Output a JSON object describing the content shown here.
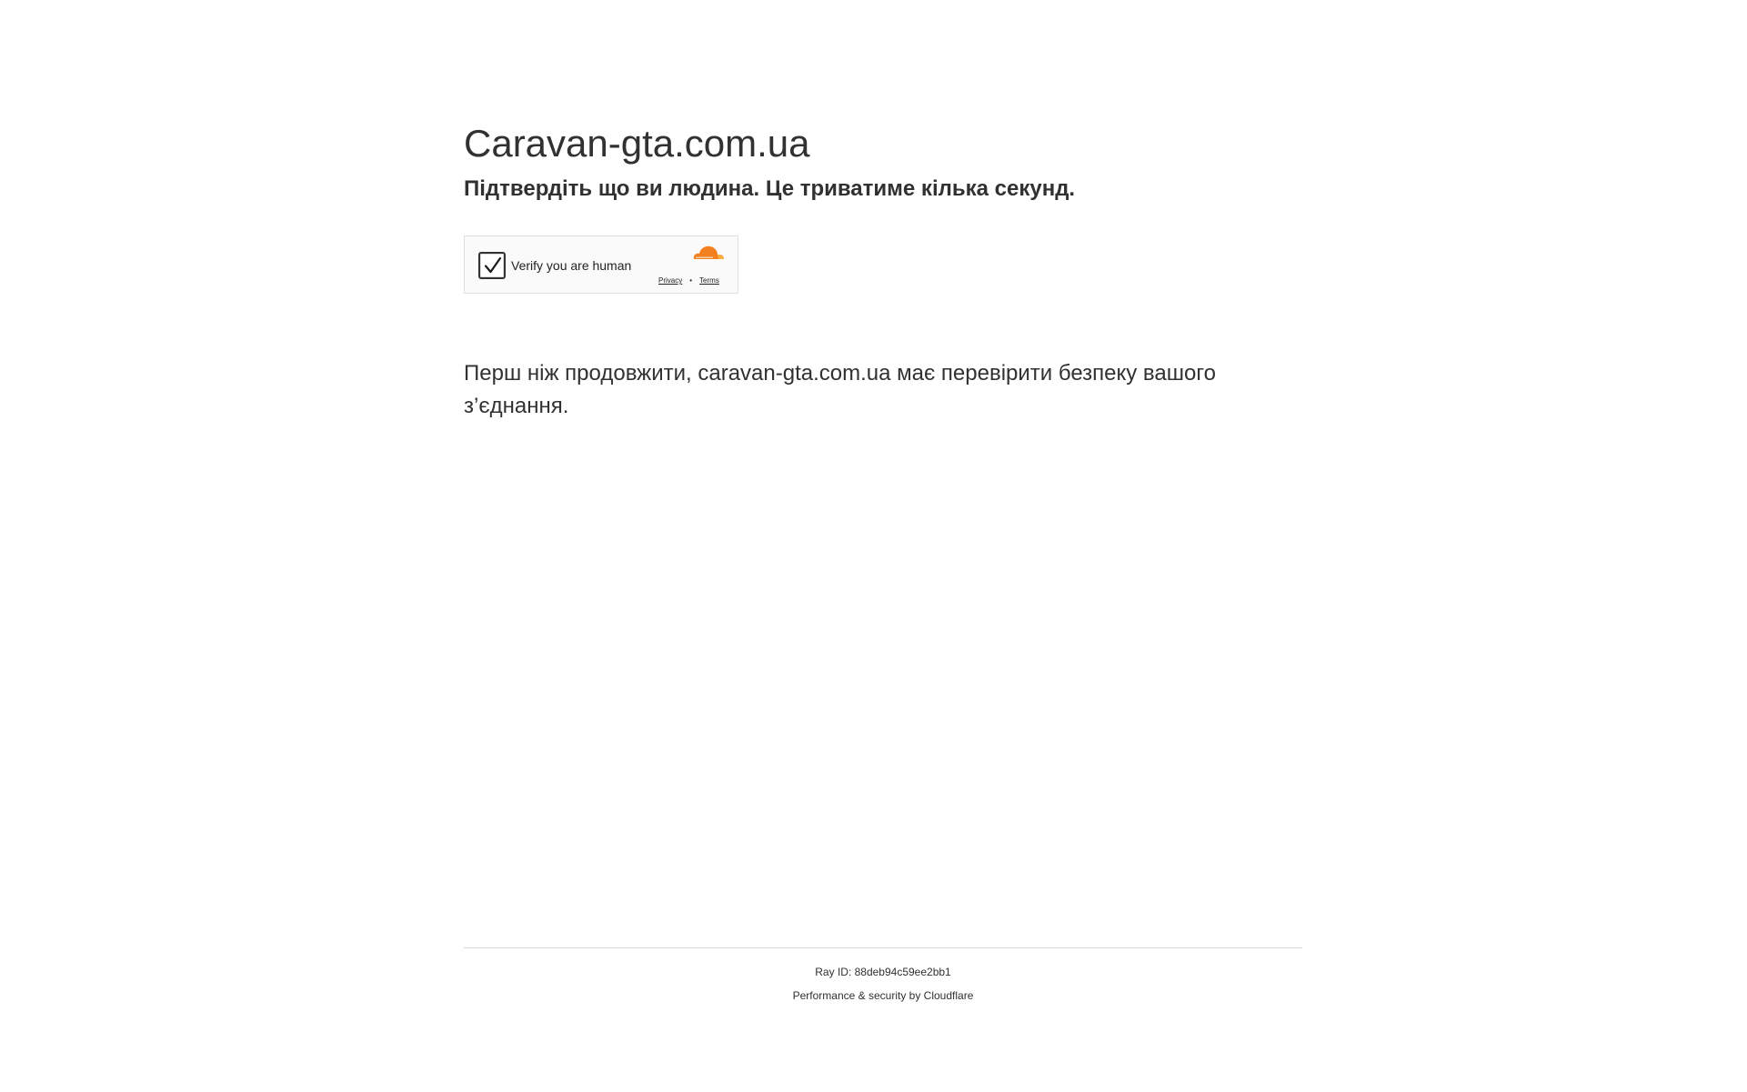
{
  "header": {
    "site_title": "Caravan-gta.com.ua",
    "subtitle": "Підтвердіть що ви людина. Це триватиме кілька секунд."
  },
  "turnstile": {
    "checkbox_label": "Verify you are human",
    "checked": true,
    "logo_icon": "cloudflare-logo",
    "privacy_link": "Privacy",
    "separator": "•",
    "terms_link": "Terms"
  },
  "main": {
    "message": "Перш ніж продовжити, caravan-gta.com.ua має перевірити безпеку вашого з’єднання."
  },
  "footer": {
    "ray_prefix": "Ray ID: ",
    "ray_id": "88deb94c59ee2bb1",
    "performance_text": "Performance & security by ",
    "cloudflare_link": "Cloudflare"
  },
  "colors": {
    "text": "#313131",
    "cloudflare_orange": "#f38020",
    "cloudflare_light_orange": "#faae40",
    "widget_border": "#e0e0e0",
    "divider": "#d9d9d9"
  }
}
